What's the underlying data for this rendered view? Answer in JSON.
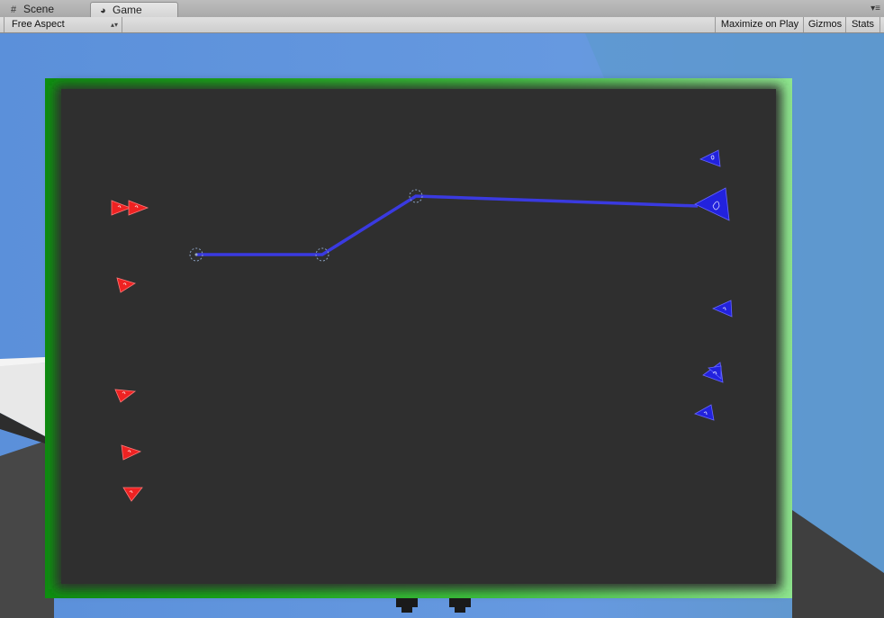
{
  "tabs": [
    {
      "label": "Scene",
      "icon": "grid-icon"
    },
    {
      "label": "Game",
      "icon": "pacman-icon",
      "active": true
    }
  ],
  "toolbar": {
    "aspect": "Free Aspect",
    "maximize": "Maximize on Play",
    "gizmos": "Gizmos",
    "stats": "Stats"
  },
  "scene": {
    "sky_color": "#5a8fd8",
    "board_color": "#2f2f2f",
    "border_color": "#22bb22",
    "team_red": "#ee2222",
    "team_blue": "#2222dd",
    "path_color": "#3a3ae0"
  }
}
